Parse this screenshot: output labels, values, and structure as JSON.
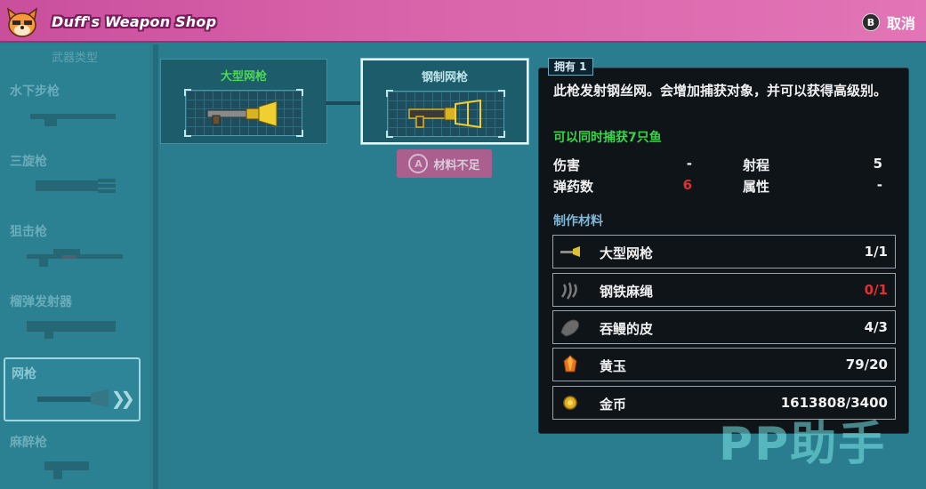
{
  "header": {
    "title": "Duff's Weapon Shop",
    "cancel_key": "B",
    "cancel_label": "取消"
  },
  "sidebar": {
    "heading": "武器类型",
    "items": [
      {
        "label": "水下步枪",
        "icon": "rifle-icon",
        "active": false
      },
      {
        "label": "三旋枪",
        "icon": "triple-gun-icon",
        "active": false
      },
      {
        "label": "狙击枪",
        "icon": "sniper-icon",
        "active": false
      },
      {
        "label": "榴弹发射器",
        "icon": "grenade-launcher-icon",
        "active": false
      },
      {
        "label": "网枪",
        "icon": "net-gun-icon",
        "active": true
      },
      {
        "label": "麻醉枪",
        "icon": "tranquilizer-gun-icon",
        "active": false
      }
    ]
  },
  "tree": {
    "nodes": [
      {
        "label": "大型网枪",
        "color": "#49d94b",
        "icon": "large-net-gun-icon"
      },
      {
        "label": "钢制网枪",
        "color": "#bfe3ea",
        "icon": "steel-net-gun-icon"
      }
    ],
    "craft_key": "A",
    "craft_label": "材料不足"
  },
  "detail": {
    "owned": "拥有 1",
    "description": "此枪发射钢丝网。会增加捕获对象，并可以获得高级别。",
    "bonus": "可以同时捕获7只鱼",
    "stats": {
      "damage_label": "伤害",
      "damage_value": "-",
      "range_label": "射程",
      "range_value": "5",
      "ammo_label": "弹药数",
      "ammo_value": "6",
      "attribute_label": "属性",
      "attribute_value": "-"
    },
    "materials_title": "制作材料",
    "materials": [
      {
        "name": "大型网枪",
        "count": "1/1",
        "sufficient": true,
        "icon": "net-gun-icon"
      },
      {
        "name": "钢铁麻绳",
        "count": "0/1",
        "sufficient": false,
        "icon": "steel-rope-icon"
      },
      {
        "name": "吞鳗的皮",
        "count": "4/3",
        "sufficient": true,
        "icon": "eel-skin-icon"
      },
      {
        "name": "黄玉",
        "count": "79/20",
        "sufficient": true,
        "icon": "topaz-icon"
      },
      {
        "name": "金币",
        "count": "1613808/3400",
        "sufficient": true,
        "icon": "gold-coin-icon"
      }
    ]
  },
  "watermark": "PP助手",
  "colors": {
    "header": "#d862a9",
    "background": "#2a7d8f",
    "panel": "#0f1419",
    "green": "#37d54a",
    "red": "#e03030"
  }
}
